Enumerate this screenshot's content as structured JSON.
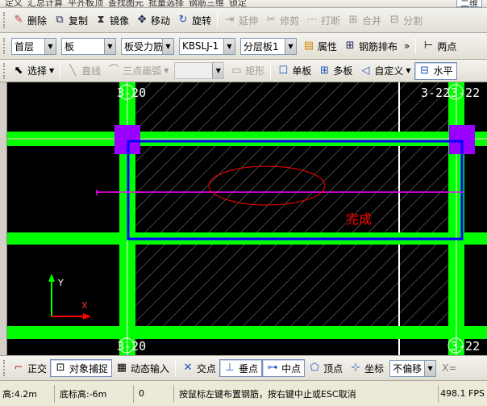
{
  "menu_row": {
    "items": [
      "定义",
      "汇总计算",
      "平齐板顶",
      "查找图元",
      "批量选择",
      "钢筋三维",
      "锁定"
    ],
    "right_combo": "二维"
  },
  "edit_toolbar": {
    "delete": "删除",
    "copy": "复制",
    "mirror": "镜像",
    "move": "移动",
    "rotate": "旋转",
    "extend": "延伸",
    "trim": "修剪",
    "break": "打断",
    "merge": "合并",
    "split": "分割"
  },
  "property_toolbar": {
    "floor": "首层",
    "component_type": "板",
    "rebar_type": "板受力筋",
    "rebar_name": "KBSLJ-1",
    "layer": "分层板1",
    "properties": "属性",
    "rebar_layout": "钢筋排布",
    "more": "»",
    "two_points": "两点"
  },
  "draw_toolbar": {
    "select": "选择",
    "line": "直线",
    "arc": "三点画弧",
    "rect": "矩形",
    "single_board": "单板",
    "multi_board": "多板",
    "custom": "自定义",
    "horizontal": "水平"
  },
  "canvas": {
    "axis_labels": [
      "3-20",
      "3-22",
      "3-22",
      "3-20",
      "3-22"
    ],
    "done_text": "完成",
    "y_axis": "Y",
    "x_axis": "X"
  },
  "snap_toolbar": {
    "ortho": "正交",
    "object_snap": "对象捕捉",
    "dynamic_input": "动态输入",
    "intersection": "交点",
    "perpendicular": "垂点",
    "midpoint": "中点",
    "vertex": "顶点",
    "coordinate": "坐标",
    "offset": "不偏移",
    "x_label": "X="
  },
  "statusbar": {
    "floor_height": "高:4.2m",
    "bottom_elev": "底标高:-6m",
    "count": "0",
    "hint": "按鼠标左键布置钢筋，按右键中止或ESC取消",
    "fps": "498.1 FPS"
  },
  "colors": {
    "beam": "#00ff00",
    "column": "#9900ff",
    "rebar": "#0000ff",
    "selection": "#ff0000",
    "guide": "#ff00ff",
    "hatch": "#8a8a8a"
  }
}
